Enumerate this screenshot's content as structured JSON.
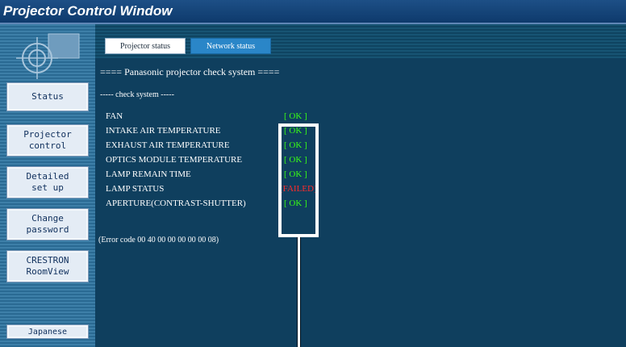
{
  "window": {
    "title": "Projector Control Window"
  },
  "sidebar": {
    "logo_icon": "projector-logo-icon",
    "buttons": [
      {
        "label": "Status"
      },
      {
        "label": "Projector\ncontrol"
      },
      {
        "label": "Detailed\nset up"
      },
      {
        "label": "Change\npassword"
      },
      {
        "label": "CRESTRON\nRoomView"
      }
    ],
    "language_button": "Japanese"
  },
  "tabs": {
    "projector_status": "Projector status",
    "network_status": "Network status"
  },
  "content": {
    "header": "==== Panasonic projector check system ====",
    "subheader": "----- check system -----",
    "items": [
      {
        "label": "FAN",
        "status": "[ OK ]"
      },
      {
        "label": "INTAKE AIR TEMPERATURE",
        "status": "[ OK ]"
      },
      {
        "label": "EXHAUST AIR TEMPERATURE",
        "status": "[ OK ]"
      },
      {
        "label": "OPTICS MODULE TEMPERATURE",
        "status": "[ OK ]"
      },
      {
        "label": "LAMP REMAIN TIME",
        "status": "[ OK ]"
      },
      {
        "label": "LAMP STATUS",
        "status": "[FAILED]"
      },
      {
        "label": "APERTURE(CONTRAST-SHUTTER)",
        "status": "[ OK ]"
      }
    ],
    "error_code": "(Error code 00 40 00 00 00 00 00 08)"
  },
  "colors": {
    "ok": "#39ff14",
    "failed": "#ff2b2b",
    "panel": "#0f3f5e"
  }
}
